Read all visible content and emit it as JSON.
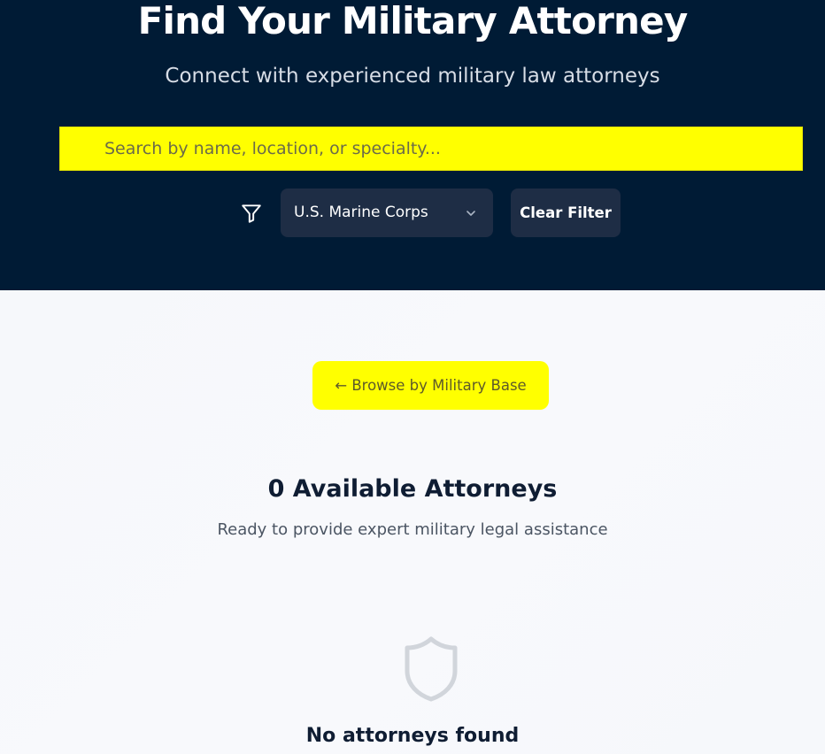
{
  "hero": {
    "title": "Find Your Military Attorney",
    "subtitle": "Connect with experienced military law attorneys",
    "background_color": "#001b35"
  },
  "search": {
    "placeholder": "Search by name, location, or specialty...",
    "value": "",
    "background_color": "#ffff00"
  },
  "filters": {
    "filter_icon": "filter-funnel-icon",
    "branch_select": {
      "selected": "U.S. Marine Corps",
      "icon": "chevron-down-icon"
    },
    "clear_label": "Clear Filter"
  },
  "browse": {
    "label": "← Browse by Military Base",
    "background_color": "#ffff00"
  },
  "results": {
    "count_title": "0 Available Attorneys",
    "subtitle": "Ready to provide expert military legal assistance"
  },
  "empty_state": {
    "icon": "shield-icon",
    "title": "No attorneys found"
  }
}
